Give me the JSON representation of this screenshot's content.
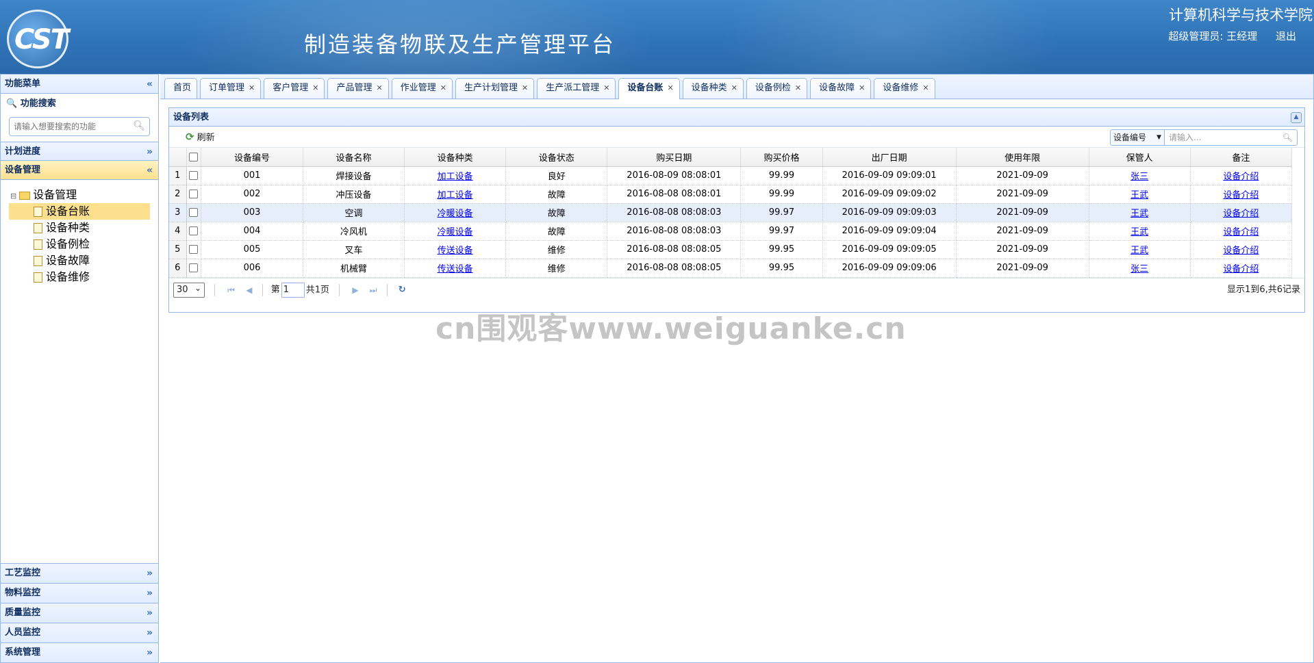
{
  "header": {
    "logo_text": "CST",
    "app_title": "制造装备物联及生产管理平台",
    "school": "计算机科学与技术学院",
    "user": "超级管理员: 王经理",
    "logout": "退出"
  },
  "sidebar": {
    "title": "功能菜单",
    "collapse_icon": "«",
    "search_title": "功能搜索",
    "search_placeholder": "请输入想要搜索的功能",
    "menus_top": [
      {
        "label": "计划进度",
        "arrow": "»"
      },
      {
        "label": "设备管理",
        "arrow": "«"
      }
    ],
    "tree_root": "设备管理",
    "tree_items": [
      "设备台账",
      "设备种类",
      "设备例检",
      "设备故障",
      "设备维修"
    ],
    "menus_bottom": [
      {
        "label": "工艺监控",
        "arrow": "»"
      },
      {
        "label": "物料监控",
        "arrow": "»"
      },
      {
        "label": "质量监控",
        "arrow": "»"
      },
      {
        "label": "人员监控",
        "arrow": "»"
      },
      {
        "label": "系统管理",
        "arrow": "»"
      }
    ]
  },
  "tabs": [
    {
      "label": "首页",
      "closable": false
    },
    {
      "label": "订单管理",
      "closable": true
    },
    {
      "label": "客户管理",
      "closable": true
    },
    {
      "label": "产品管理",
      "closable": true
    },
    {
      "label": "作业管理",
      "closable": true
    },
    {
      "label": "生产计划管理",
      "closable": true
    },
    {
      "label": "生产派工管理",
      "closable": true
    },
    {
      "label": "设备台账",
      "closable": true,
      "active": true
    },
    {
      "label": "设备种类",
      "closable": true
    },
    {
      "label": "设备例检",
      "closable": true
    },
    {
      "label": "设备故障",
      "closable": true
    },
    {
      "label": "设备维修",
      "closable": true
    }
  ],
  "grid": {
    "title": "设备列表",
    "refresh_label": "刷新",
    "search_field": "设备编号",
    "search_placeholder": "请输入...",
    "columns": [
      "设备编号",
      "设备名称",
      "设备种类",
      "设备状态",
      "购买日期",
      "购买价格",
      "出厂日期",
      "使用年限",
      "保管人",
      "备注"
    ],
    "rows": [
      [
        "001",
        "焊接设备",
        "加工设备",
        "良好",
        "2016-08-09 08:08:01",
        "99.99",
        "2016-09-09 09:09:01",
        "2021-09-09",
        "张三",
        "设备介绍"
      ],
      [
        "002",
        "冲压设备",
        "加工设备",
        "故障",
        "2016-08-08 08:08:01",
        "99.99",
        "2016-09-09 09:09:02",
        "2021-09-09",
        "王武",
        "设备介绍"
      ],
      [
        "003",
        "空调",
        "冷暖设备",
        "故障",
        "2016-08-08 08:08:03",
        "99.97",
        "2016-09-09 09:09:03",
        "2021-09-09",
        "王武",
        "设备介绍"
      ],
      [
        "004",
        "冷风机",
        "冷暖设备",
        "故障",
        "2016-08-08 08:08:03",
        "99.97",
        "2016-09-09 09:09:04",
        "2021-09-09",
        "王武",
        "设备介绍"
      ],
      [
        "005",
        "叉车",
        "传送设备",
        "维修",
        "2016-08-08 08:08:05",
        "99.95",
        "2016-09-09 09:09:05",
        "2021-09-09",
        "王武",
        "设备介绍"
      ],
      [
        "006",
        "机械臂",
        "传送设备",
        "维修",
        "2016-08-08 08:08:05",
        "99.95",
        "2016-09-09 09:09:06",
        "2021-09-09",
        "张三",
        "设备介绍"
      ]
    ],
    "highlighted_row": 3
  },
  "pager": {
    "page_size": "30",
    "page_prefix": "第",
    "page_value": "1",
    "page_suffix": "共1页",
    "info": "显示1到6,共6记录"
  },
  "watermark": "cn围观客www.weiguanke.cn",
  "colors": {
    "header_bg": "#2f74b8",
    "border": "#95b8e7",
    "selected": "#fde08e",
    "link": "#0000ee"
  }
}
